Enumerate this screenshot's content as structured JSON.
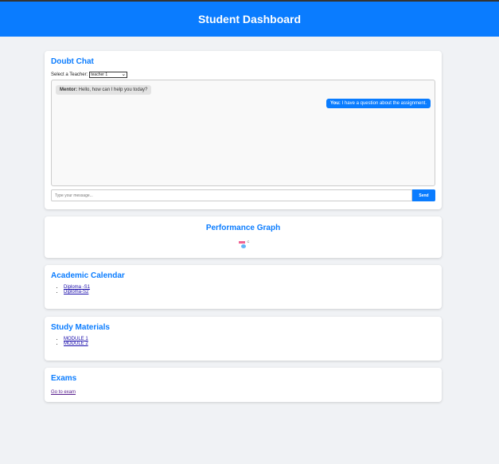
{
  "header": {
    "title": "Student Dashboard"
  },
  "chat": {
    "title": "Doubt Chat",
    "select_label": "Select a Teacher:",
    "selected_teacher": "teacher 1",
    "messages": [
      {
        "sender": "Mentor:",
        "text": "Hello, how can I help you today?"
      },
      {
        "sender": "You:",
        "text": "I have a question about the assignment."
      }
    ],
    "input_placeholder": "Type your message...",
    "send_label": "Send"
  },
  "performance": {
    "title": "Performance Graph",
    "image_alt": "C"
  },
  "calendar": {
    "title": "Academic Calendar",
    "items": [
      {
        "label": "Diploma -S1"
      },
      {
        "label": "Diploma-S2"
      }
    ]
  },
  "study": {
    "title": "Study Materials",
    "items": [
      {
        "label": "MODULE 1"
      },
      {
        "label": "MODULE 2"
      }
    ]
  },
  "exams": {
    "title": "Exams",
    "link": "Go to exam"
  },
  "colors": {
    "accent": "#0a7cff",
    "background": "#f0f2f5",
    "link": "#1a0dab",
    "visited_link": "#551a8b"
  },
  "icons": {
    "performance_image": "broken-image-icon",
    "select_chevron": "chevron-down-icon"
  }
}
